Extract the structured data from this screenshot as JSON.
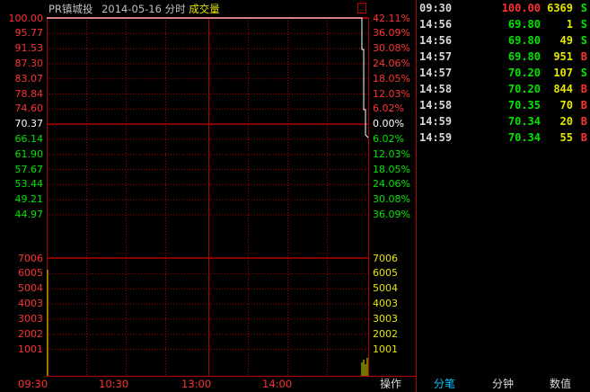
{
  "chart": {
    "title_prefix": "PR镇城投",
    "title_date": "2014-05-16 分时",
    "title_indicator": "成交量",
    "price_labels": [
      {
        "price": "100.00",
        "pct": "42.11%",
        "color": "red"
      },
      {
        "price": "95.77",
        "pct": "36.09%",
        "color": "red"
      },
      {
        "price": "91.53",
        "pct": "30.08%",
        "color": "red"
      },
      {
        "price": "87.30",
        "pct": "24.06%",
        "color": "red"
      },
      {
        "price": "83.07",
        "pct": "18.05%",
        "color": "red"
      },
      {
        "price": "78.84",
        "pct": "12.03%",
        "color": "red"
      },
      {
        "price": "74.60",
        "pct": "6.02%",
        "color": "red"
      },
      {
        "price": "70.37",
        "pct": "0.00%",
        "color": "white"
      },
      {
        "price": "66.14",
        "pct": "6.02%",
        "color": "green"
      },
      {
        "price": "61.90",
        "pct": "12.03%",
        "color": "green"
      },
      {
        "price": "57.67",
        "pct": "18.05%",
        "color": "green"
      },
      {
        "price": "53.44",
        "pct": "24.06%",
        "color": "green"
      },
      {
        "price": "49.21",
        "pct": "30.08%",
        "color": "green"
      },
      {
        "price": "44.97",
        "pct": "36.09%",
        "color": "green"
      }
    ],
    "volume_labels": [
      "7006",
      "6005",
      "5004",
      "4003",
      "3003",
      "2002",
      "1001"
    ],
    "time_labels": [
      "09:30",
      "10:30",
      "13:00",
      "14:00"
    ]
  },
  "ticks": [
    {
      "time": "09:30",
      "price": "100.00",
      "volume": "6369",
      "side": "S",
      "price_color": "#ff3232",
      "side_color": "#00e600"
    },
    {
      "time": "14:56",
      "price": "69.80",
      "volume": "1",
      "side": "S",
      "price_color": "#00e600",
      "side_color": "#00e600"
    },
    {
      "time": "14:56",
      "price": "69.80",
      "volume": "49",
      "side": "S",
      "price_color": "#00e600",
      "side_color": "#00e600"
    },
    {
      "time": "14:57",
      "price": "69.80",
      "volume": "951",
      "side": "B",
      "price_color": "#00e600",
      "side_color": "#ff3232"
    },
    {
      "time": "14:57",
      "price": "70.20",
      "volume": "107",
      "side": "S",
      "price_color": "#00e600",
      "side_color": "#00e600"
    },
    {
      "time": "14:58",
      "price": "70.20",
      "volume": "844",
      "side": "B",
      "price_color": "#00e600",
      "side_color": "#ff3232"
    },
    {
      "time": "14:58",
      "price": "70.35",
      "volume": "70",
      "side": "B",
      "price_color": "#00e600",
      "side_color": "#ff3232"
    },
    {
      "time": "14:59",
      "price": "70.34",
      "volume": "20",
      "side": "B",
      "price_color": "#00e600",
      "side_color": "#ff3232"
    },
    {
      "time": "14:59",
      "price": "70.34",
      "volume": "55",
      "side": "B",
      "price_color": "#00e600",
      "side_color": "#ff3232"
    }
  ],
  "tabs": [
    {
      "label": "操作",
      "active": false
    },
    {
      "label": "分笔",
      "active": true
    },
    {
      "label": "分钟",
      "active": false
    },
    {
      "label": "数值",
      "active": false
    }
  ],
  "colors": {
    "grid": "#b40000",
    "up": "#ff3232",
    "down": "#00e600",
    "volume": "#e6e600",
    "active_tab": "#00c8ff"
  }
}
